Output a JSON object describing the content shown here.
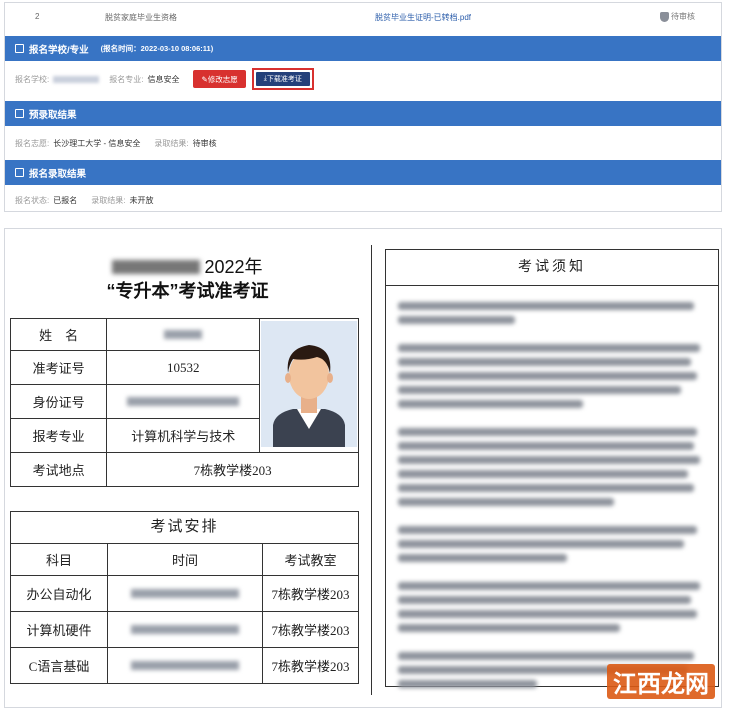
{
  "top": {
    "file_row": {
      "index": "2",
      "name": "脱贫家庭毕业生资格",
      "link": "脱贫毕业生证明-已转档.pdf",
      "status": "待审核"
    },
    "school_section": {
      "title": "报名学校/专业",
      "time": "(报名时间：2022-03-10 08:06:11)",
      "school_label": "报名学校:",
      "major_label": "报名专业:",
      "major_value": "信息安全",
      "edit_button": "修改志愿",
      "download_button": "下载准考证"
    },
    "pre_admit_section": {
      "title": "预录取结果",
      "choice_label": "报名志愿:",
      "choice_value": "长沙理工大学 - 信息安全",
      "result_label": "录取结果:",
      "result_value": "待审核"
    },
    "admit_section": {
      "title": "报名录取结果",
      "status_label": "报名状态:",
      "status_value": "已报名",
      "result_label": "录取结果:",
      "result_value": "未开放"
    }
  },
  "ticket": {
    "year_title": "2022年",
    "subtitle": "“专升本”考试准考证",
    "info": {
      "name_label": "姓　名",
      "ticket_no_label": "准考证号",
      "ticket_no_value": "10532",
      "id_label": "身份证号",
      "major_label": "报考专业",
      "major_value": "计算机科学与技术",
      "location_label": "考试地点",
      "location_value": "7栋教学楼203"
    },
    "schedule_title": "考试安排",
    "schedule_headers": [
      "科目",
      "时间",
      "考试教室"
    ],
    "schedule_rows": [
      {
        "subject": "办公自动化",
        "room": "7栋教学楼203"
      },
      {
        "subject": "计算机硬件",
        "room": "7栋教学楼203"
      },
      {
        "subject": "C语言基础",
        "room": "7栋教学楼203"
      }
    ],
    "notice_title": "考试须知"
  },
  "watermark": "江西龙网"
}
